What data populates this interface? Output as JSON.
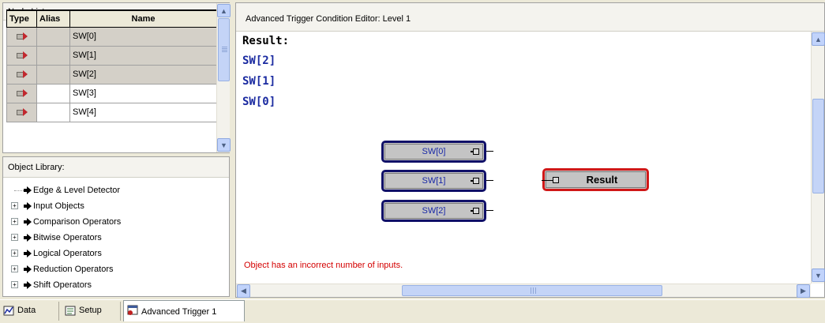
{
  "node_list": {
    "header": "Node List:",
    "columns": [
      "Type",
      "Alias",
      "Name"
    ],
    "rows": [
      {
        "name": "SW[0]",
        "selected": true
      },
      {
        "name": "SW[1]",
        "selected": true
      },
      {
        "name": "SW[2]",
        "selected": true
      },
      {
        "name": "SW[3]",
        "selected": false
      },
      {
        "name": "SW[4]",
        "selected": false
      }
    ]
  },
  "object_library": {
    "header": "Object Library:",
    "items": [
      {
        "label": "Edge & Level Detector",
        "expandable": false
      },
      {
        "label": "Input Objects",
        "expandable": true
      },
      {
        "label": "Comparison Operators",
        "expandable": true
      },
      {
        "label": "Bitwise Operators",
        "expandable": true
      },
      {
        "label": "Logical Operators",
        "expandable": true
      },
      {
        "label": "Reduction Operators",
        "expandable": true
      },
      {
        "label": "Shift Operators",
        "expandable": true
      }
    ]
  },
  "editor": {
    "title": "Advanced Trigger Condition Editor: Level 1",
    "result_label": "Result:",
    "result_lines": [
      "SW[2]",
      "SW[1]",
      "SW[0]"
    ],
    "nodes": [
      "SW[0]",
      "SW[1]",
      "SW[2]"
    ],
    "result_node": "Result",
    "error": "Object has an incorrect number of inputs.",
    "colors": {
      "error": "#d40000",
      "result_text": "#1a2aa0",
      "result_border": "#d01818",
      "node_border": "#101068"
    }
  },
  "tabs": [
    {
      "label": "Data",
      "icon": "data-icon"
    },
    {
      "label": "Setup",
      "icon": "setup-icon"
    },
    {
      "label": "Advanced Trigger 1",
      "icon": "advanced-trigger-icon",
      "active": true
    }
  ]
}
